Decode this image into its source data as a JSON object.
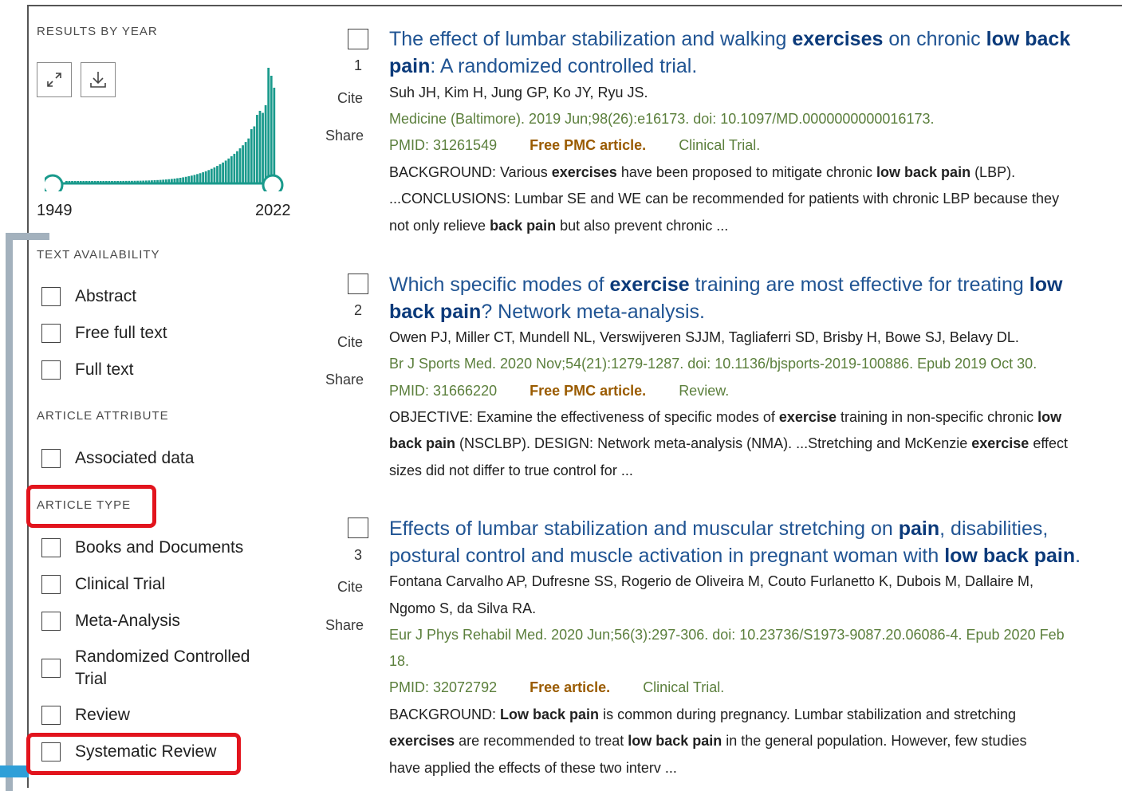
{
  "sidebar": {
    "results_by_year": {
      "title": "RESULTS BY YEAR",
      "expand_icon": "expand-icon",
      "download_icon": "download-icon",
      "start_year": "1949",
      "end_year": "2022"
    },
    "text_availability": {
      "title": "TEXT AVAILABILITY",
      "items": [
        "Abstract",
        "Free full text",
        "Full text"
      ]
    },
    "article_attribute": {
      "title": "ARTICLE ATTRIBUTE",
      "items": [
        "Associated data"
      ]
    },
    "article_type": {
      "title": "ARTICLE TYPE",
      "items": [
        "Books and Documents",
        "Clinical Trial",
        "Meta-Analysis",
        "Randomized Controlled",
        "Review",
        "Systematic Review"
      ],
      "item_line2": "Trial"
    }
  },
  "results": [
    {
      "number": "1",
      "cite": "Cite",
      "share": "Share",
      "title_parts": [
        "The effect of lumbar stabilization and walking ",
        "exercises",
        " on chronic ",
        "low back",
        "pain",
        ": A randomized controlled trial."
      ],
      "authors": "Suh JH, Kim H, Jung GP, Ko JY, Ryu JS.",
      "journal": "Medicine (Baltimore). 2019 Jun;98(26):e16173. doi: 10.1097/MD.0000000000016173.",
      "pmid": "PMID: 31261549",
      "free": "Free PMC article.",
      "type": "Clinical Trial.",
      "snippet1": [
        "BACKGROUND: Various ",
        "exercises",
        " have been proposed to mitigate chronic ",
        "low back pain",
        " (LBP)."
      ],
      "snippet2": "...CONCLUSIONS: Lumbar SE and WE can be recommended for patients with chronic LBP because they",
      "snippet3": [
        "not only relieve ",
        "back pain",
        " but also prevent chronic ..."
      ]
    },
    {
      "number": "2",
      "cite": "Cite",
      "share": "Share",
      "title_parts": [
        "Which specific modes of ",
        "exercise",
        " training are most effective for treating ",
        "low",
        "back pain",
        "? Network meta-analysis."
      ],
      "authors": "Owen PJ, Miller CT, Mundell NL, Verswijveren SJJM, Tagliaferri SD, Brisby H, Bowe SJ, Belavy DL.",
      "journal": "Br J Sports Med. 2020 Nov;54(21):1279-1287. doi: 10.1136/bjsports-2019-100886. Epub 2019 Oct 30.",
      "pmid": "PMID: 31666220",
      "free": "Free PMC article.",
      "type": "Review.",
      "snippet1": [
        "OBJECTIVE: Examine the effectiveness of specific modes of ",
        "exercise",
        " training in non-specific chronic ",
        "low",
        ""
      ],
      "snippet2_parts": [
        "back pain",
        " (NSCLBP). DESIGN: Network meta-analysis (NMA). ...Stretching and McKenzie ",
        "exercise",
        " effect"
      ],
      "snippet3": [
        "sizes did not differ to true control for ...",
        "",
        ""
      ]
    },
    {
      "number": "3",
      "cite": "Cite",
      "share": "Share",
      "title_parts": [
        "Effects of lumbar stabilization and muscular stretching on ",
        "pain",
        ", disabilities,",
        "postural control and muscle activation in pregnant woman with ",
        "low back pain",
        "."
      ],
      "authors": "Fontana Carvalho AP, Dufresne SS, Rogerio de Oliveira M, Couto Furlanetto K, Dubois M, Dallaire M,",
      "authors2": "Ngomo S, da Silva RA.",
      "journal": "Eur J Phys Rehabil Med. 2020 Jun;56(3):297-306. doi: 10.23736/S1973-9087.20.06086-4. Epub 2020 Feb",
      "journal2": "18.",
      "pmid": "PMID: 32072792",
      "free": "Free article.",
      "type": "Clinical Trial.",
      "snippet1": [
        "BACKGROUND: ",
        "Low back pain",
        " is common during pregnancy. Lumbar stabilization and stretching",
        "",
        ""
      ],
      "snippet2_parts": [
        "exercises",
        " are recommended to treat ",
        "low back pain",
        " in the general population. However, few studies"
      ],
      "snippet3": [
        "have applied the effects of these two interv ...",
        "",
        ""
      ]
    }
  ],
  "colors": {
    "title_blue": "#205493",
    "journal_green": "#5b7f3c",
    "free_orange": "#9a5b00",
    "histogram_teal": "#1a9a8c",
    "highlight_red": "#e2141d"
  }
}
